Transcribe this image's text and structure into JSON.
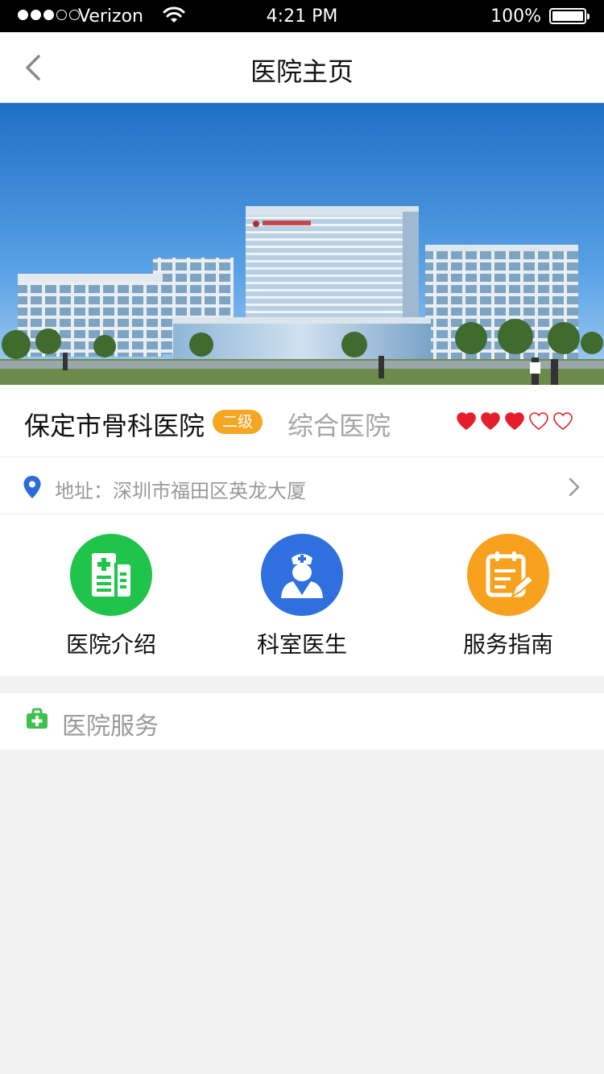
{
  "status_bar": {
    "carrier": "Verizon",
    "time": "4:21 PM",
    "battery": "100%",
    "signal_strength": 3,
    "signal_max": 5
  },
  "nav": {
    "title": "医院主页",
    "back_icon": "chevron-left-icon"
  },
  "hospital": {
    "name": "保定市骨科医院",
    "level": "二级",
    "type": "综合医院",
    "rating": 3,
    "rating_max": 5,
    "address_label": "地址：",
    "address": "深圳市福田区英龙大厦"
  },
  "quick_actions": [
    {
      "label": "医院介绍",
      "icon": "hospital-building-icon",
      "color": "#21c44b"
    },
    {
      "label": "科室医生",
      "icon": "nurse-icon",
      "color": "#2f6fde"
    },
    {
      "label": "服务指南",
      "icon": "clipboard-pen-icon",
      "color": "#f7a11f"
    }
  ],
  "services": {
    "title": "医院服务",
    "icon": "medkit-icon"
  },
  "colors": {
    "accent_green": "#21c44b",
    "accent_blue": "#2f6fde",
    "accent_orange": "#f7a11f",
    "badge_orange": "#f5a623",
    "heart_red": "#e61e2b",
    "pin_blue": "#2d6ae0"
  }
}
